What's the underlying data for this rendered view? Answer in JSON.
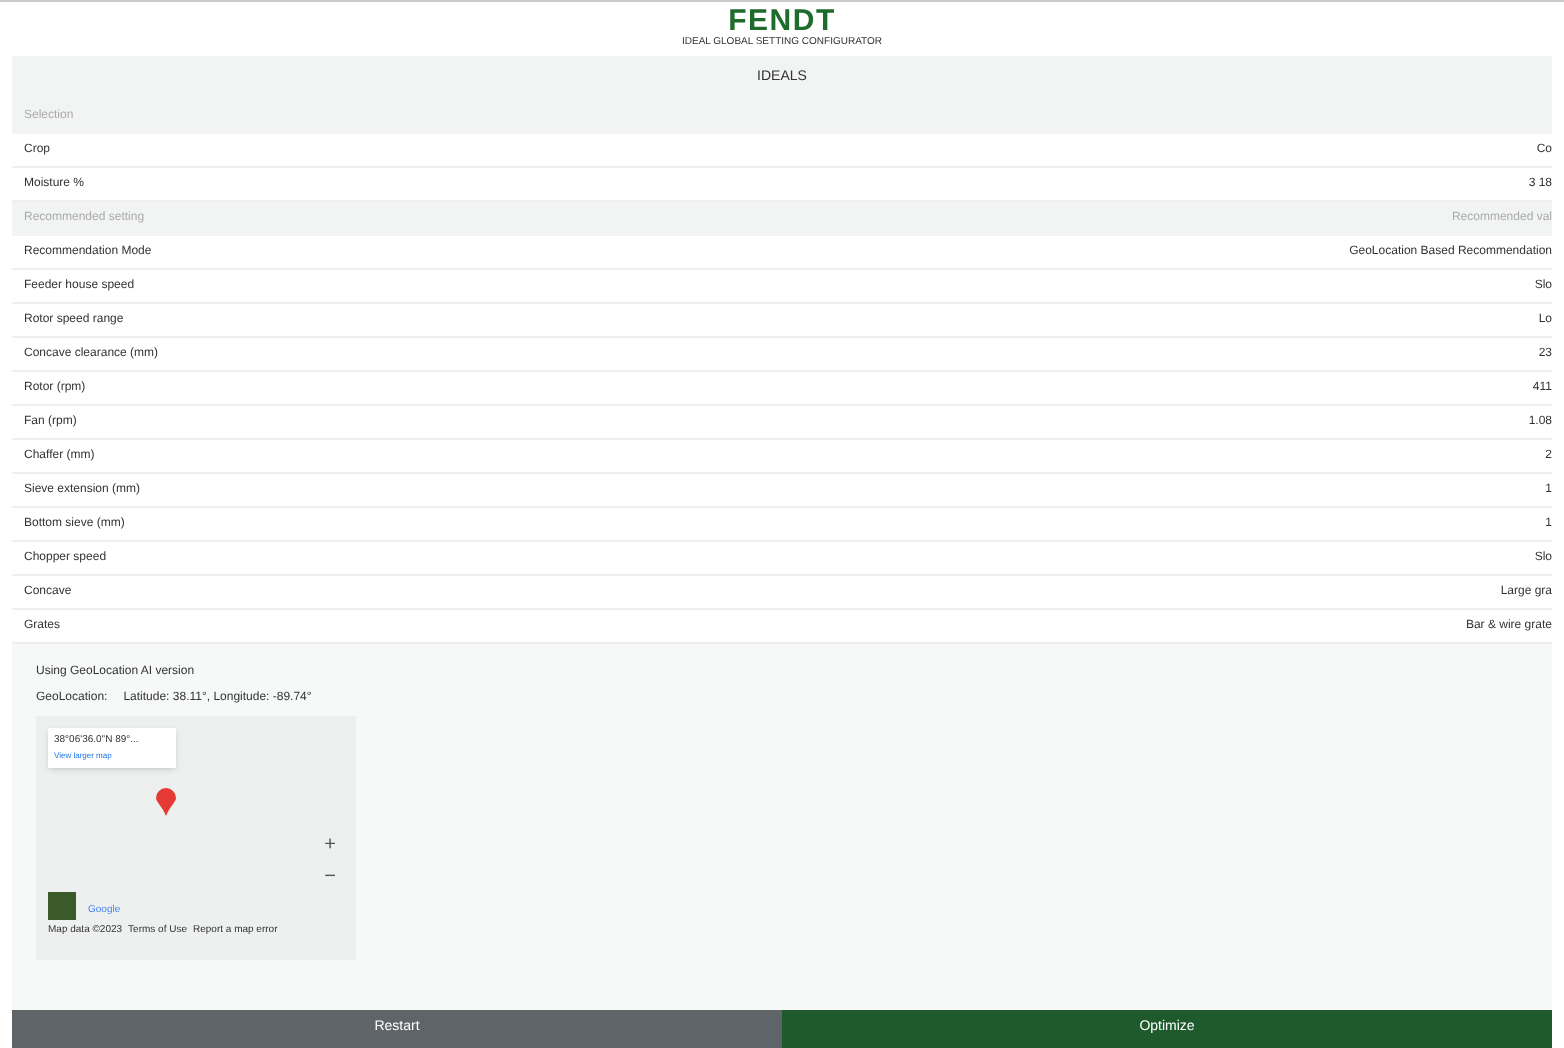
{
  "header": {
    "logo": "FENDT",
    "subtitle": "IDEAL GLOBAL SETTING CONFIGURATOR"
  },
  "title": "IDEALS",
  "sections": [
    {
      "heading": "Selection",
      "rows": [
        {
          "label": "Crop",
          "value": "Co"
        },
        {
          "label": "Moisture %",
          "value": "3 18"
        }
      ]
    },
    {
      "heading": "Recommended setting",
      "value_heading": "Recommended val",
      "rows": [
        {
          "label": "Recommendation Mode",
          "value": "GeoLocation Based Recommendation"
        },
        {
          "label": "Feeder house speed",
          "value": "Slo"
        },
        {
          "label": "Rotor speed range",
          "value": "Lo"
        },
        {
          "label": "Concave clearance (mm)",
          "value": "23"
        },
        {
          "label": "Rotor (rpm)",
          "value": "411"
        },
        {
          "label": "Fan (rpm)",
          "value": "1.08"
        },
        {
          "label": "Chaffer (mm)",
          "value": "2"
        },
        {
          "label": "Sieve extension (mm)",
          "value": "1"
        },
        {
          "label": "Bottom sieve (mm)",
          "value": "1"
        },
        {
          "label": "Chopper speed",
          "value": "Slo"
        },
        {
          "label": "Concave",
          "value": "Large gra"
        },
        {
          "label": "Grates",
          "value": "Bar & wire grate"
        }
      ]
    }
  ],
  "geo": {
    "version": "Using GeoLocation AI version",
    "location_label": "GeoLocation:",
    "coordinates": "Latitude: 38.11°, Longitude: -89.74°"
  },
  "map": {
    "place": "38°06'36.0\"N 89°...",
    "link": "View larger map",
    "zoom_in": "+",
    "zoom_out": "−",
    "brand": "Google",
    "attribution": [
      "Map data ©2023",
      "Terms of Use",
      "Report a map error"
    ]
  },
  "buttons": [
    {
      "label": "Restart",
      "kind": "secondary"
    },
    {
      "label": "Optimize",
      "kind": "primary"
    }
  ]
}
